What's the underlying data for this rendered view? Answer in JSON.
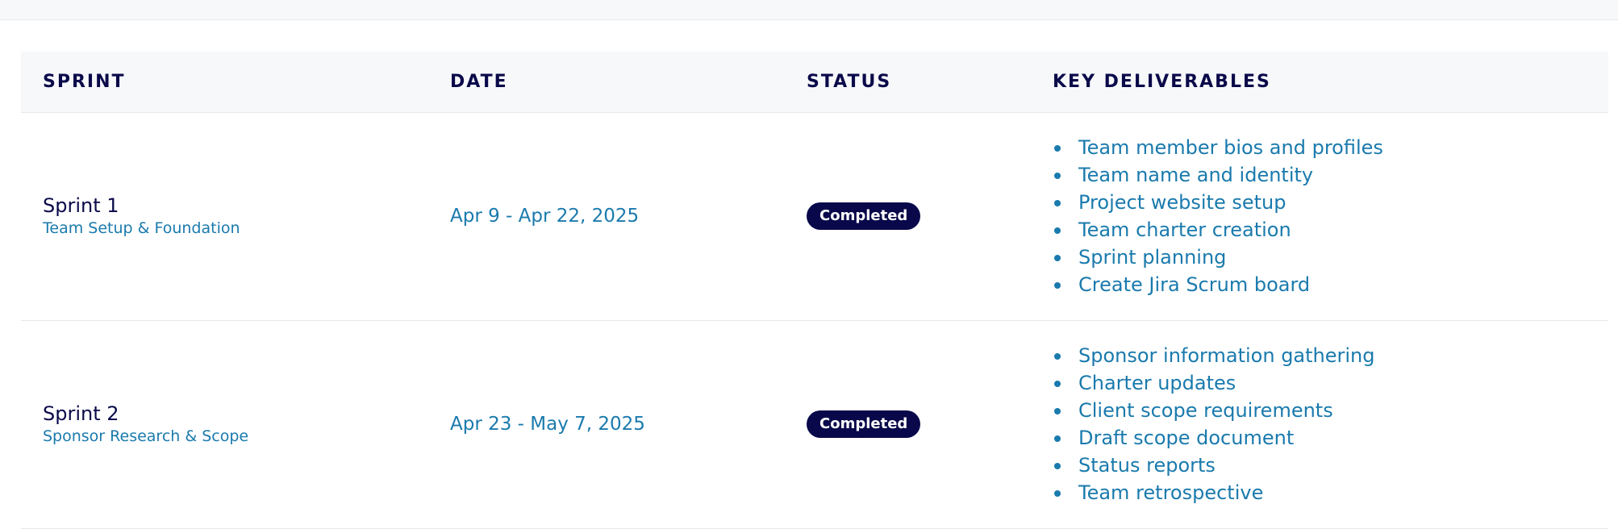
{
  "table": {
    "headers": {
      "sprint": "SPRINT",
      "date": "DATE",
      "status": "STATUS",
      "deliverables": "KEY DELIVERABLES"
    },
    "rows": [
      {
        "sprint": "Sprint 1",
        "subtitle": "Team Setup & Foundation",
        "date": "Apr 9 - Apr 22, 2025",
        "status": "Completed",
        "deliverables": [
          "Team member bios and profiles",
          "Team name and identity",
          "Project website setup",
          "Team charter creation",
          "Sprint planning",
          "Create Jira Scrum board"
        ]
      },
      {
        "sprint": "Sprint 2",
        "subtitle": "Sponsor Research & Scope",
        "date": "Apr 23 - May 7, 2025",
        "status": "Completed",
        "deliverables": [
          "Sponsor information gathering",
          "Charter updates",
          "Client scope requirements",
          "Draft scope document",
          "Status reports",
          "Team retrospective"
        ]
      }
    ]
  },
  "colors": {
    "heading": "#0a0a4a",
    "accent": "#1a7aad",
    "badge_bg": "#08084a",
    "header_bg": "#f7f8fa"
  }
}
